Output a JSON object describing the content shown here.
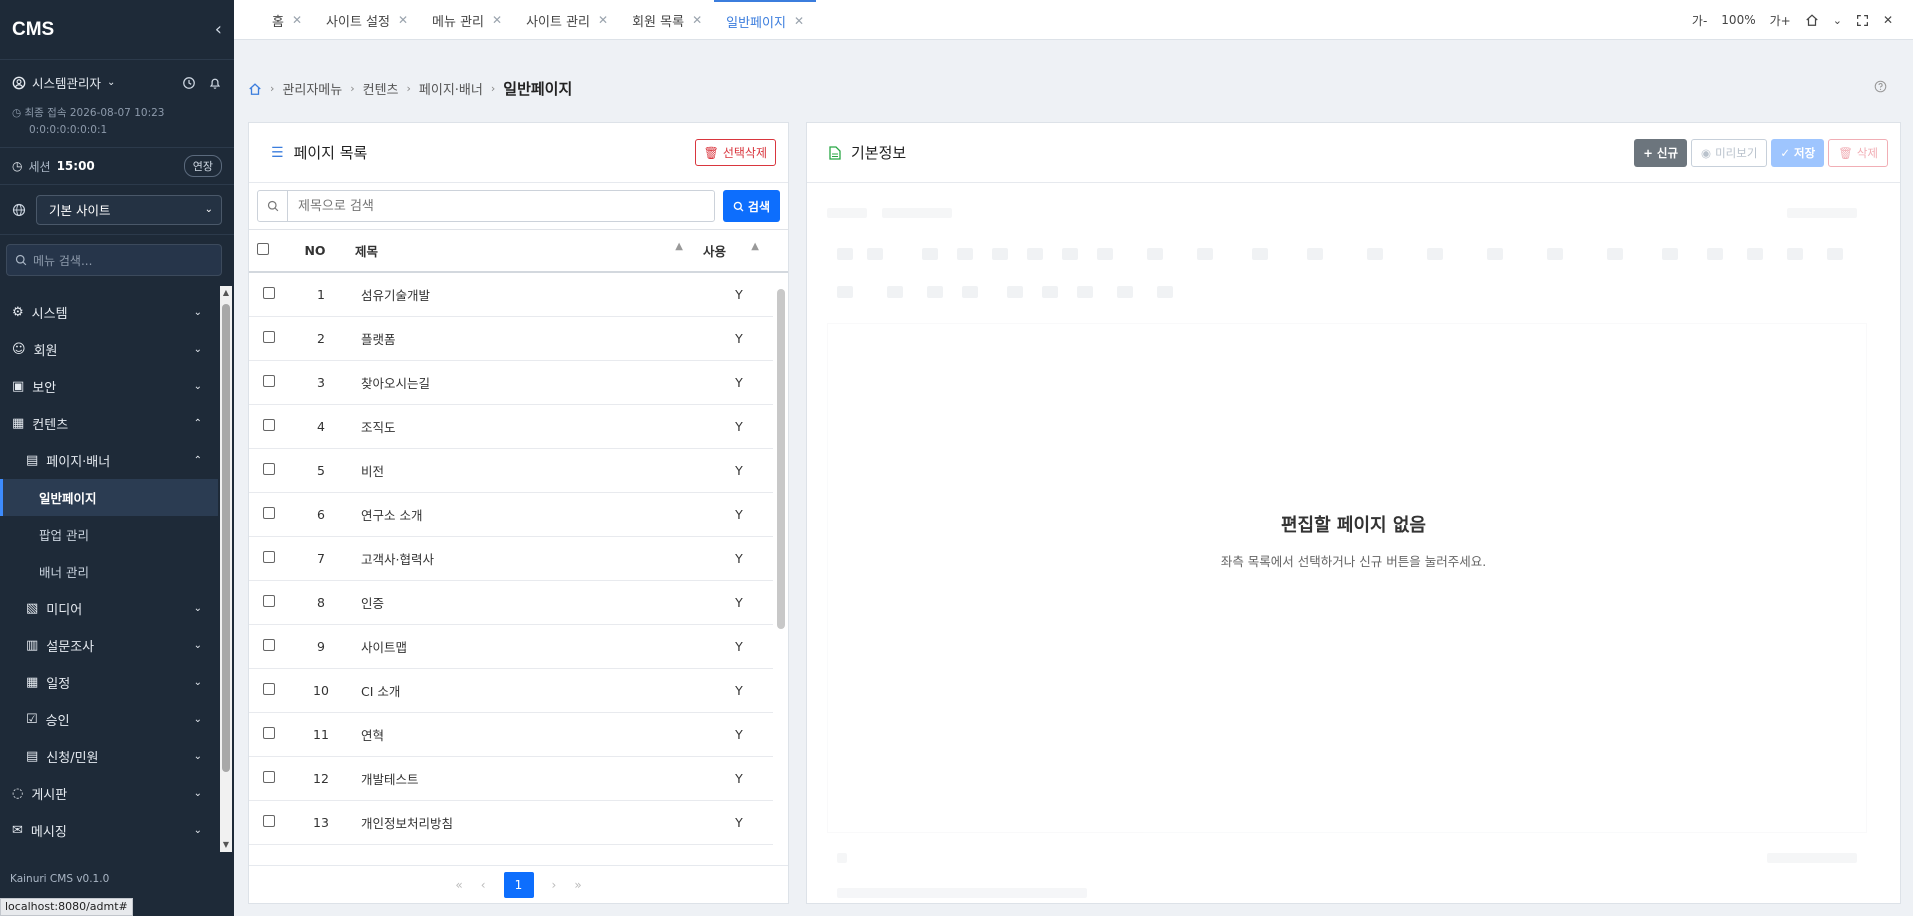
{
  "app": {
    "brand": "CMS",
    "version": "Kainuri CMS v0.1.0",
    "status_url": "localhost:8080/admt#"
  },
  "user": {
    "name": "시스템관리자"
  },
  "last_login": {
    "label": "최종 접속",
    "datetime": "2026-08-07 10:23",
    "ip": "0:0:0:0:0:0:0:1"
  },
  "session": {
    "label": "세션",
    "time": "15:00",
    "extend_label": "연장"
  },
  "site": {
    "selected": "기본 사이트"
  },
  "menu_search": {
    "placeholder": "메뉴 검색..."
  },
  "menu": {
    "system": "시스템",
    "member": "회원",
    "security": "보안",
    "contents": "컨텐츠",
    "page_banner": "페이지·배너",
    "general_page": "일반페이지",
    "popup": "팝업 관리",
    "banner": "배너 관리",
    "media": "미디어",
    "survey": "설문조사",
    "schedule": "일정",
    "approval": "승인",
    "application": "신청/민원",
    "board": "게시판",
    "messaging": "메시징"
  },
  "tabs": [
    {
      "label": "홈"
    },
    {
      "label": "사이트 설정"
    },
    {
      "label": "메뉴 관리"
    },
    {
      "label": "사이트 관리"
    },
    {
      "label": "회원 목록"
    },
    {
      "label": "일반페이지"
    }
  ],
  "top_tools": {
    "font_down": "가-",
    "zoom": "100%",
    "font_up": "가+"
  },
  "breadcrumb": {
    "b1": "관리자메뉴",
    "b2": "컨텐츠",
    "b3": "페이지·배너",
    "current": "일반페이지"
  },
  "list_panel": {
    "title": "페이지 목록",
    "delete_selected": "선택삭제",
    "search_placeholder": "제목으로 검색",
    "search_button": "검색",
    "col_no": "NO",
    "col_title": "제목",
    "col_use": "사용",
    "rows": [
      {
        "no": "1",
        "title": "섬유기술개발",
        "use": "Y"
      },
      {
        "no": "2",
        "title": "플랫폼",
        "use": "Y"
      },
      {
        "no": "3",
        "title": "찾아오시는길",
        "use": "Y"
      },
      {
        "no": "4",
        "title": "조직도",
        "use": "Y"
      },
      {
        "no": "5",
        "title": "비전",
        "use": "Y"
      },
      {
        "no": "6",
        "title": "연구소 소개",
        "use": "Y"
      },
      {
        "no": "7",
        "title": "고객사·협력사",
        "use": "Y"
      },
      {
        "no": "8",
        "title": "인증",
        "use": "Y"
      },
      {
        "no": "9",
        "title": "사이트맵",
        "use": "Y"
      },
      {
        "no": "10",
        "title": "CI 소개",
        "use": "Y"
      },
      {
        "no": "11",
        "title": "연혁",
        "use": "Y"
      },
      {
        "no": "12",
        "title": "개발테스트",
        "use": "Y"
      },
      {
        "no": "13",
        "title": "개인정보처리방침",
        "use": "Y"
      }
    ],
    "pager": {
      "first": "«",
      "prev": "‹",
      "current": "1",
      "next": "›",
      "last": "»"
    }
  },
  "info_panel": {
    "title": "기본정보",
    "new_label": "+ 신규",
    "preview_label": "미리보기",
    "save_label": "저장",
    "delete_label": "삭제",
    "empty_title": "편집할 페이지 없음",
    "empty_sub": "좌측 목록에서 선택하거나 신규 버튼을 눌러주세요."
  }
}
